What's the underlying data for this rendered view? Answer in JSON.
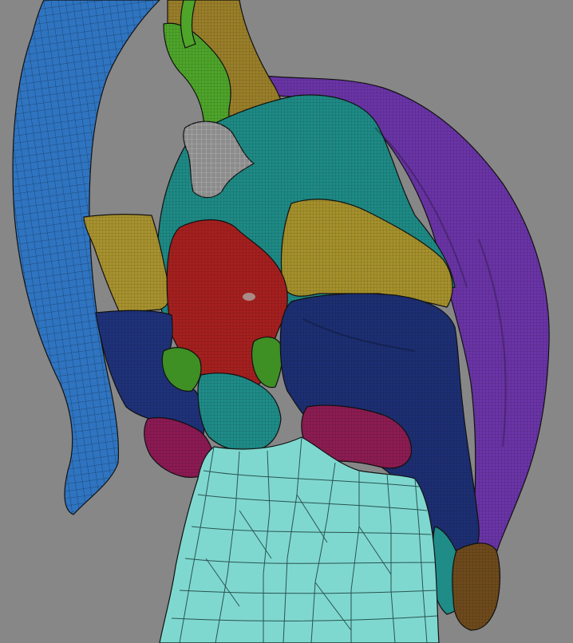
{
  "viewport": {
    "background_color": "#878787"
  },
  "mesh_parts": [
    {
      "id": "horn",
      "name": "blue-horn-mesh",
      "color": "#2f74c0"
    },
    {
      "id": "stalk",
      "name": "olive-stalk-mesh",
      "color": "#9a7f2a"
    },
    {
      "id": "stalk-band",
      "name": "green-band-mesh",
      "color": "#4ea52a"
    },
    {
      "id": "gray-nub",
      "name": "gray-nub-mesh",
      "color": "#8c8c8c"
    },
    {
      "id": "purple-shell",
      "name": "purple-shell-mesh",
      "color": "#6a34a6"
    },
    {
      "id": "teal-core",
      "name": "teal-core-mesh",
      "color": "#1e8a85"
    },
    {
      "id": "olive-left",
      "name": "olive-left-lobe-mesh",
      "color": "#a8922f"
    },
    {
      "id": "olive-right",
      "name": "olive-right-lobe-mesh",
      "color": "#a5902c"
    },
    {
      "id": "red-lobe",
      "name": "red-lobe-mesh",
      "color": "#a5201f"
    },
    {
      "id": "navy-left",
      "name": "navy-left-lobe-mesh",
      "color": "#1f327a"
    },
    {
      "id": "navy-right",
      "name": "navy-right-lobe-mesh",
      "color": "#1d2f73"
    },
    {
      "id": "green-left",
      "name": "green-left-patch-mesh",
      "color": "#3e8f24"
    },
    {
      "id": "magenta-left",
      "name": "magenta-left-lobe-mesh",
      "color": "#8c1a54"
    },
    {
      "id": "magenta-right",
      "name": "magenta-right-lobe-mesh",
      "color": "#8c1c52"
    },
    {
      "id": "teal-low",
      "name": "teal-low-mesh",
      "color": "#1f8c88"
    },
    {
      "id": "brown-tip",
      "name": "brown-tip-mesh",
      "color": "#6e4a1c"
    },
    {
      "id": "cyan-column",
      "name": "cyan-column-mesh",
      "color": "#7fd8d0"
    }
  ]
}
